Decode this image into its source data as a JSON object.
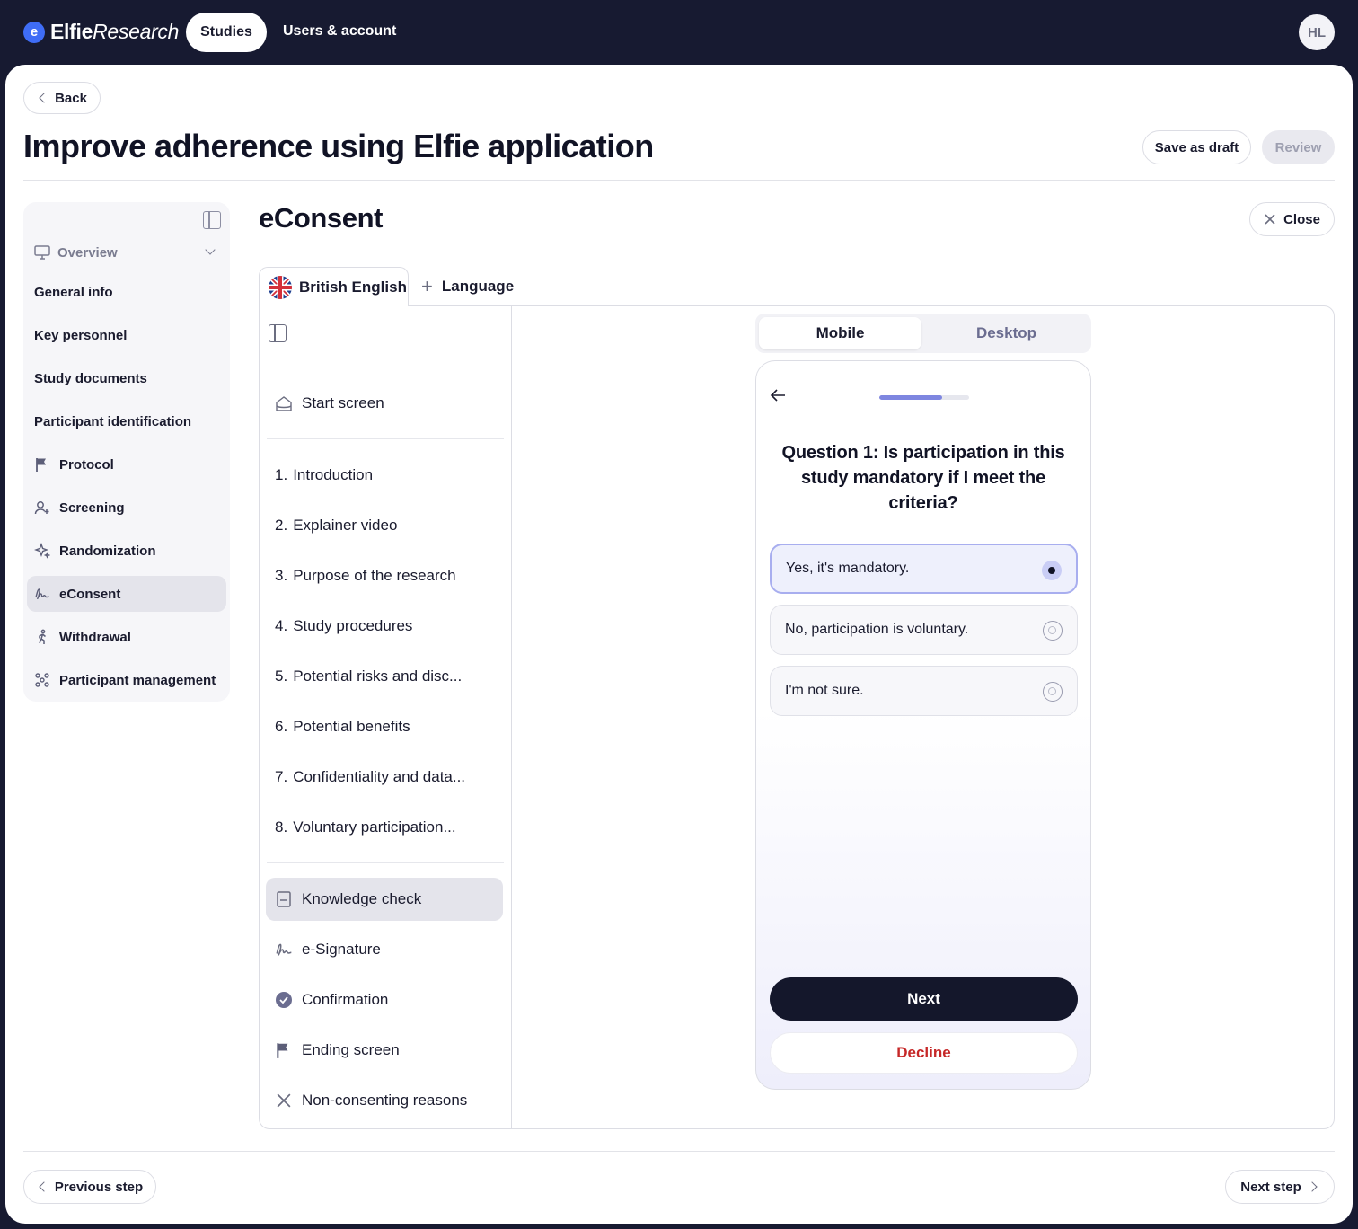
{
  "topbar": {
    "logo_bold": "Elfie",
    "logo_thin": "Research",
    "nav_studies": "Studies",
    "nav_users": "Users & account",
    "avatar_initials": "HL"
  },
  "header": {
    "back_label": "Back",
    "title": "Improve adherence using Elfie application",
    "save_draft_label": "Save as draft",
    "review_label": "Review"
  },
  "sidebar": {
    "overview_label": "Overview",
    "items": [
      {
        "label": "General info",
        "icon": ""
      },
      {
        "label": "Key personnel",
        "icon": ""
      },
      {
        "label": "Study documents",
        "icon": ""
      },
      {
        "label": "Participant identification",
        "icon": ""
      },
      {
        "label": "Protocol",
        "icon": "flag-icon"
      },
      {
        "label": "Screening",
        "icon": "user-plus-icon"
      },
      {
        "label": "Randomization",
        "icon": "sparkle-icon"
      },
      {
        "label": "eConsent",
        "icon": "signature-icon",
        "active": true
      },
      {
        "label": "Withdrawal",
        "icon": "walking-icon"
      },
      {
        "label": "Participant management",
        "icon": "group-icon"
      }
    ]
  },
  "section": {
    "title": "eConsent",
    "close_label": "Close",
    "language_tab": "British English",
    "add_language": "Language"
  },
  "steps": {
    "start_screen": "Start screen",
    "numbered": [
      {
        "num": "1.",
        "label": "Introduction"
      },
      {
        "num": "2.",
        "label": "Explainer video"
      },
      {
        "num": "3.",
        "label": "Purpose of the research"
      },
      {
        "num": "4.",
        "label": "Study procedures"
      },
      {
        "num": "5.",
        "label": "Potential risks and disc..."
      },
      {
        "num": "6.",
        "label": "Potential benefits"
      },
      {
        "num": "7.",
        "label": "Confidentiality and data..."
      },
      {
        "num": "8.",
        "label": "Voluntary participation..."
      }
    ],
    "extra": [
      {
        "label": "Knowledge check",
        "icon": "book-icon",
        "active": true
      },
      {
        "label": "e-Signature",
        "icon": "signature-icon"
      },
      {
        "label": "Confirmation",
        "icon": "check-circle-icon"
      },
      {
        "label": "Ending screen",
        "icon": "flag-icon"
      },
      {
        "label": "Non-consenting reasons",
        "icon": "close-icon"
      }
    ]
  },
  "preview": {
    "toggle_mobile": "Mobile",
    "toggle_desktop": "Desktop",
    "progress_fraction": 0.7,
    "question": "Question 1: Is participation in this study mandatory if I meet the criteria?",
    "options": [
      {
        "label": "Yes, it's mandatory.",
        "selected": true
      },
      {
        "label": "No, participation is voluntary.",
        "selected": false
      },
      {
        "label": "I'm not sure.",
        "selected": false
      }
    ],
    "next_label": "Next",
    "decline_label": "Decline"
  },
  "footer": {
    "previous_label": "Previous step",
    "next_label": "Next step"
  },
  "colors": {
    "topbar_bg": "#171a31",
    "accent": "#7e86e0",
    "decline": "#c62828"
  }
}
